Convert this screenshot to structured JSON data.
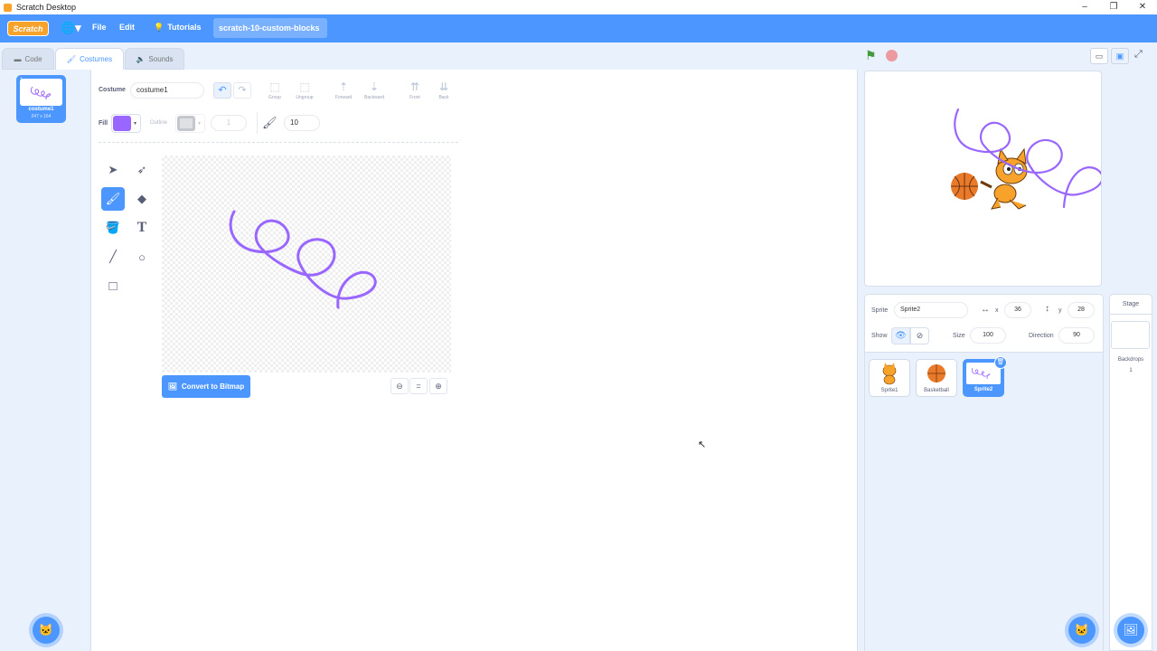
{
  "window": {
    "title": "Scratch Desktop",
    "controls": [
      "–",
      "❐",
      "✕"
    ]
  },
  "menubar": {
    "logo_text": "Scratch",
    "language_icon": "globe-icon",
    "file_label": "File",
    "edit_label": "Edit",
    "tutorials_label": "Tutorials",
    "project_title": "scratch-10-custom-blocks"
  },
  "tabs": {
    "code": "Code",
    "costumes": "Costumes",
    "sounds": "Sounds",
    "active": "Costumes"
  },
  "costume_list": {
    "items": [
      {
        "number": "1",
        "name": "costume1",
        "size": "247 x 164",
        "selected": true
      }
    ]
  },
  "paint_editor": {
    "costume_label": "Costume",
    "costume_name": "costume1",
    "buttons": {
      "group": "Group",
      "ungroup": "Ungroup",
      "forward": "Forward",
      "backward": "Backward",
      "front": "Front",
      "back": "Back"
    },
    "fill_label": "Fill",
    "fill_color": "#9966ff",
    "outline_label": "Outline",
    "outline_width": "1",
    "brush_size": "10",
    "convert_label": "Convert to Bitmap",
    "zoom_reset": "="
  },
  "sprite_info": {
    "sprite_label": "Sprite",
    "sprite_name": "Sprite2",
    "x_label": "x",
    "x_value": "36",
    "y_label": "y",
    "y_value": "28",
    "show_label": "Show",
    "size_label": "Size",
    "size_value": "100",
    "direction_label": "Direction",
    "direction_value": "90"
  },
  "sprites": [
    {
      "name": "Sprite1",
      "selected": false
    },
    {
      "name": "Basketball",
      "selected": false
    },
    {
      "name": "Sprite2",
      "selected": true
    }
  ],
  "stage_pane": {
    "title": "Stage",
    "backdrops_label": "Backdrops",
    "backdrops_count": "1"
  },
  "colors": {
    "brand_blue": "#4c97ff",
    "scratch_orange": "#f7a32b",
    "stroke_purple": "#9966ff"
  }
}
